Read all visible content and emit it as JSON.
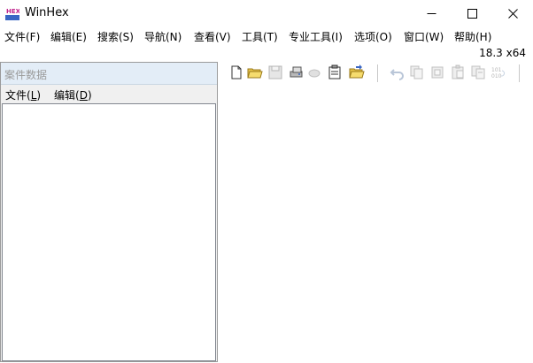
{
  "window": {
    "title": "WinHex",
    "icon_text": "HEX",
    "version": "18.3 x64",
    "controls": [
      "minimize-icon",
      "maximize-icon",
      "close-icon"
    ]
  },
  "menubar": {
    "items": [
      {
        "label": "文件(F)"
      },
      {
        "label": "编辑(E)"
      },
      {
        "label": "搜索(S)"
      },
      {
        "label": "导航(N)"
      },
      {
        "label": "查看(V)"
      },
      {
        "label": "工具(T)"
      },
      {
        "label": "专业工具(I)"
      },
      {
        "label": "选项(O)"
      },
      {
        "label": "窗口(W)"
      },
      {
        "label": "帮助(H)"
      }
    ]
  },
  "case_panel": {
    "title": "案件数据",
    "menu": [
      {
        "label": "文件(",
        "key": "L",
        "suffix": ")"
      },
      {
        "label": "编辑(",
        "key": "D",
        "suffix": ")"
      }
    ]
  },
  "toolbar": {
    "icons": [
      "new-file-icon",
      "open-folder-icon",
      "save-icon",
      "open-disk-icon",
      "disabled-icon",
      "properties-icon",
      "open-folder-arrow-icon",
      "undo-icon",
      "copy-icon",
      "cut-icon",
      "paste-icon",
      "paste-special-icon",
      "binary-icon"
    ]
  },
  "colors": {
    "accent": "#3a66c4",
    "panel_title_bg": "#e3edf7",
    "disabled": "#b5b5b5"
  }
}
